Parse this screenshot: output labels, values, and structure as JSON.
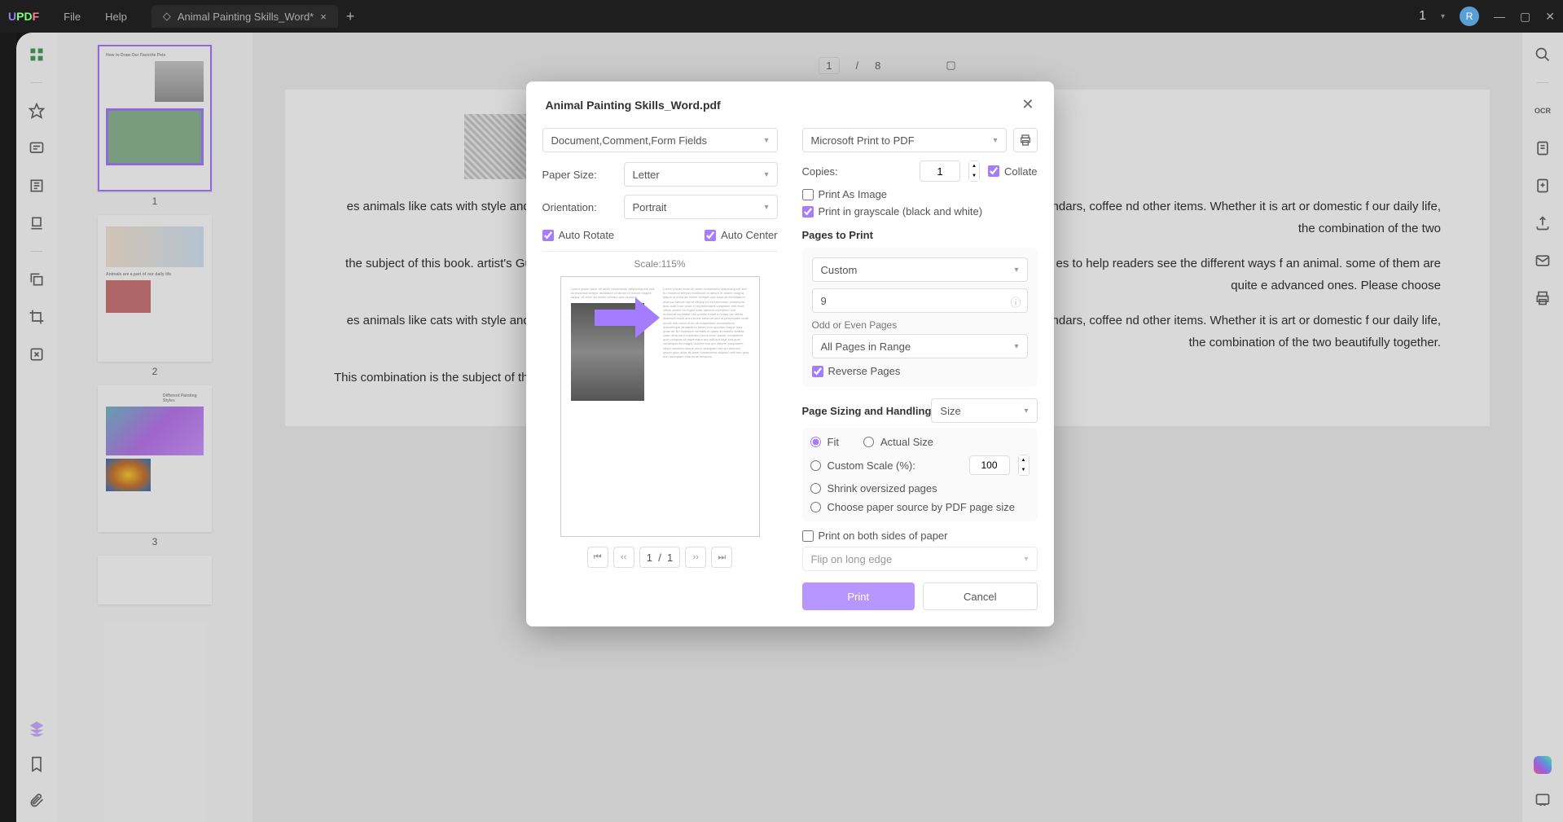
{
  "titlebar": {
    "logo_u": "U",
    "logo_pd": "PD",
    "logo_f": "F",
    "menu_file": "File",
    "menu_help": "Help",
    "tab_title": "Animal Painting Skills_Word*",
    "notification_count": "1",
    "avatar_letter": "R"
  },
  "thumbnails": {
    "pages": [
      "1",
      "2",
      "3"
    ]
  },
  "toolbar": {
    "page_current": "1",
    "page_sep": "/",
    "page_total": "8"
  },
  "document": {
    "p1": "es animals like cats with style and style s, this horse has inspired s, jewelry, and even armor. nowadays rt sells a lot of t-shirts, calendars, coffee nd other items. Whether it is art or domestic f our daily life, the combination of the two",
    "p2": "the subject of this book. artist's Guide aims to provide people with tepping stones for improvement gs. I provide many sketches and es to help readers see the different ways f an animal. some of them are quite e advanced ones. Please choose",
    "p3": "es animals like cats with style and style s, this horse has inspired s, jewelry, and even armor. nowadays rt sells a lot of t-shirts, calendars, coffee nd other items. Whether it is art or domestic f our daily life, the combination of the two beautifully together.",
    "p4": "This combination is the subject of this book. artist's"
  },
  "modal": {
    "title": "Animal Painting Skills_Word.pdf",
    "type_select": "Document,Comment,Form Fields",
    "paper_size_label": "Paper Size:",
    "paper_size": "Letter",
    "orientation_label": "Orientation:",
    "orientation": "Portrait",
    "auto_rotate": "Auto Rotate",
    "auto_center": "Auto Center",
    "scale_text": "Scale:115%",
    "pager_current": "1",
    "pager_sep": "/",
    "pager_total": "1",
    "printer": "Microsoft Print to PDF",
    "copies_label": "Copies:",
    "copies_value": "1",
    "collate": "Collate",
    "print_as_image": "Print As Image",
    "print_grayscale": "Print in grayscale (black and white)",
    "pages_to_print": "Pages to Print",
    "pages_mode": "Custom",
    "pages_value": "9",
    "odd_even_label": "Odd or Even Pages",
    "odd_even": "All Pages in Range",
    "reverse_pages": "Reverse Pages",
    "page_sizing": "Page Sizing and Handling",
    "size_select": "Size",
    "fit": "Fit",
    "actual_size": "Actual Size",
    "custom_scale": "Custom Scale (%):",
    "custom_scale_value": "100",
    "shrink": "Shrink oversized pages",
    "paper_source": "Choose paper source by PDF page size",
    "both_sides": "Print on both sides of paper",
    "flip": "Flip on long edge",
    "print_btn": "Print",
    "cancel_btn": "Cancel"
  }
}
